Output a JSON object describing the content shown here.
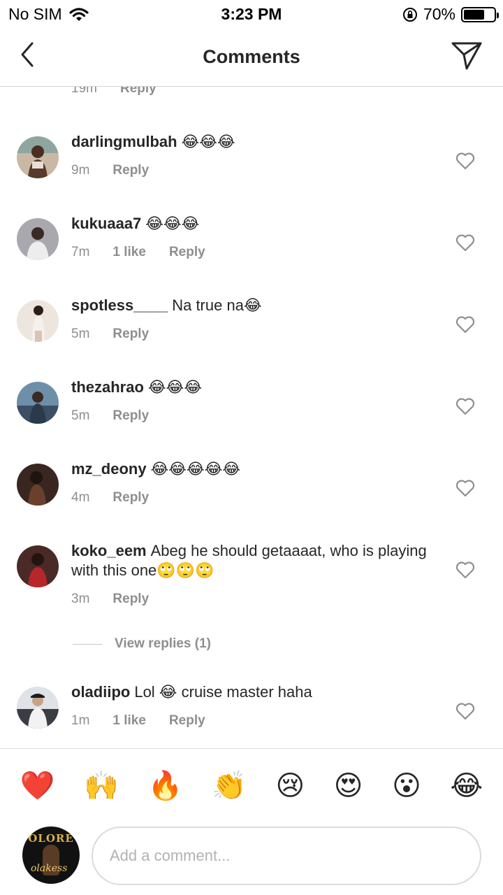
{
  "status_bar": {
    "carrier": "No SIM",
    "time": "3:23 PM",
    "battery": "70%",
    "battery_level": 0.7
  },
  "header": {
    "title": "Comments"
  },
  "partial_comment": {
    "time": "19m",
    "reply": "Reply"
  },
  "comments": [
    {
      "user": "darlingmulbah",
      "text": "😂😂😂",
      "time": "9m",
      "likes": "",
      "reply": "Reply"
    },
    {
      "user": "kukuaaa7",
      "text": "😂😂😂",
      "time": "7m",
      "likes": "1 like",
      "reply": "Reply"
    },
    {
      "user": "spotless____",
      "text": "Na true na😂",
      "time": "5m",
      "likes": "",
      "reply": "Reply"
    },
    {
      "user": "thezahrao",
      "text": "😂😂😂",
      "time": "5m",
      "likes": "",
      "reply": "Reply"
    },
    {
      "user": "mz_deony",
      "text": "😂😂😂😂😂",
      "time": "4m",
      "likes": "",
      "reply": "Reply"
    },
    {
      "user": "koko_eem",
      "text": "Abeg he should getaaaat, who is playing with this one🙄🙄🙄",
      "time": "3m",
      "likes": "",
      "reply": "Reply"
    },
    {
      "user": "oladiipo",
      "text": "Lol 😂 cruise master haha",
      "time": "1m",
      "likes": "1 like",
      "reply": "Reply"
    }
  ],
  "view_replies": "View replies (1)",
  "quick_emojis": [
    "❤️",
    "🙌",
    "🔥",
    "👏",
    "😢",
    "😍",
    "😮",
    "😂"
  ],
  "composer": {
    "avatar_brand": "OLORE",
    "avatar_signature": "olakess",
    "placeholder": "Add a comment..."
  }
}
